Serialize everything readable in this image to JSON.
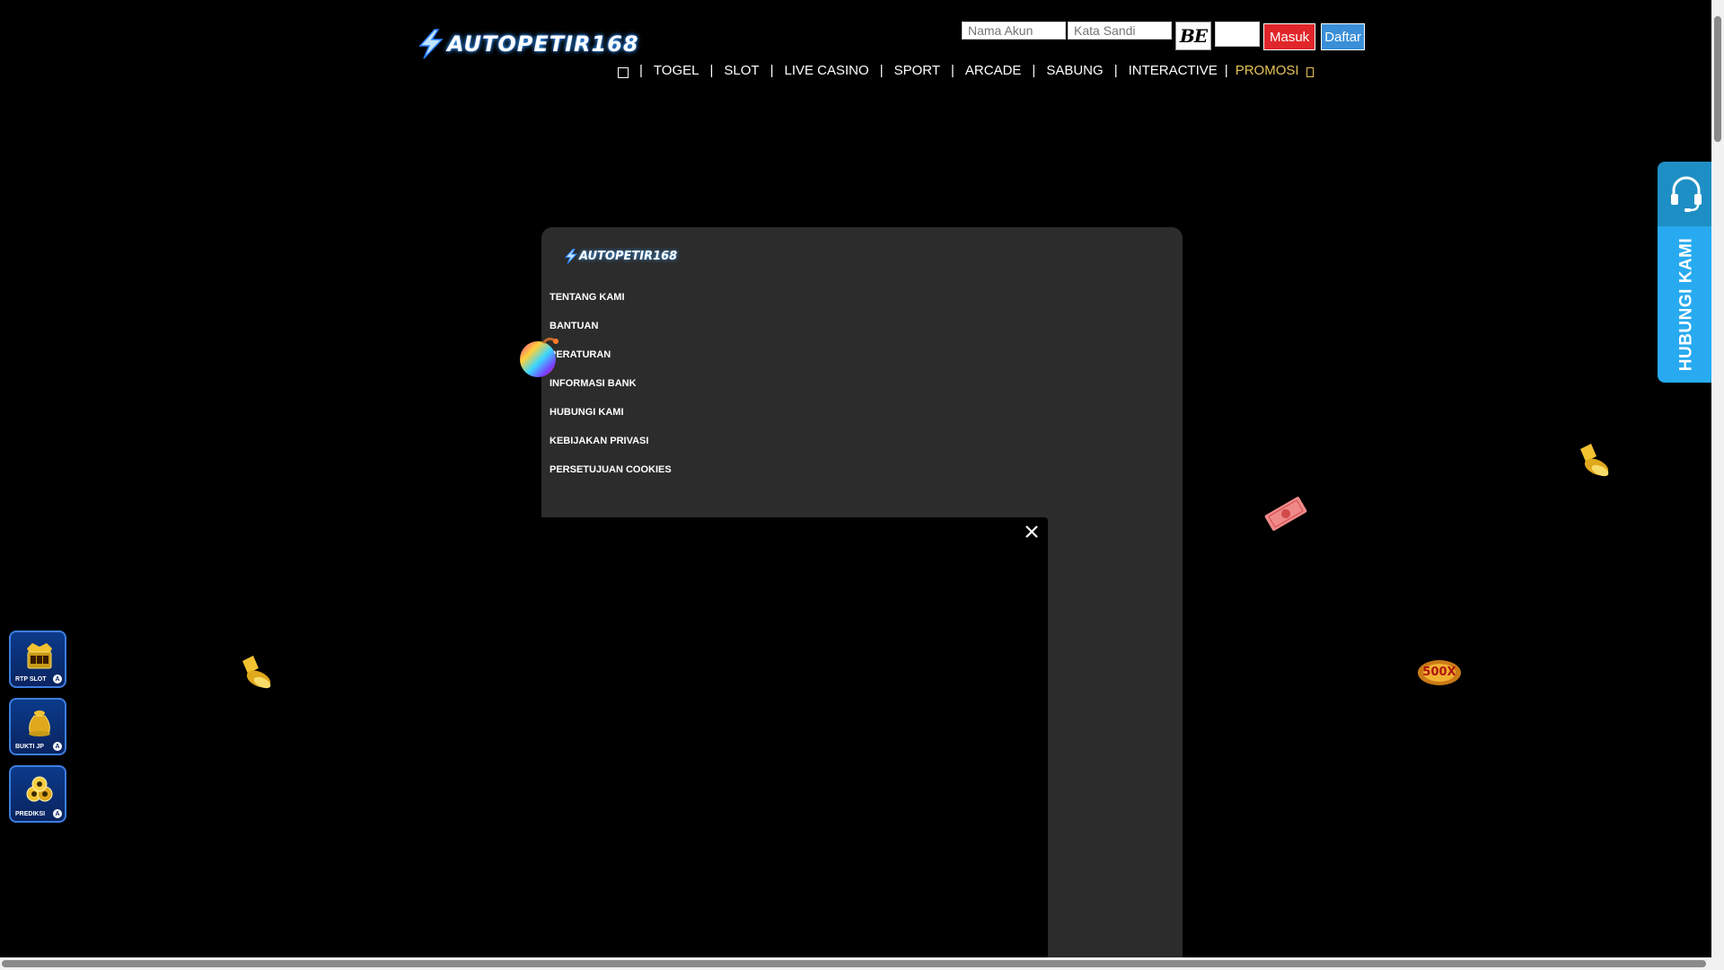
{
  "header": {
    "logo_text": "AUTOPETIR168",
    "username_placeholder": "Nama Akun",
    "password_placeholder": "Kata Sandi",
    "captcha_text": "BE",
    "login_label": "Masuk",
    "register_label": "Daftar"
  },
  "nav": {
    "items": [
      "TOGEL",
      "SLOT",
      "LIVE CASINO",
      "SPORT",
      "ARCADE",
      "SABUNG",
      "INTERACTIVE"
    ],
    "promo": "PROMOSI"
  },
  "panel": {
    "logo_text": "AUTOPETIR168",
    "menu": [
      "TENTANG KAMI",
      "BANTUAN",
      "PERATURAN",
      "INFORMASI BANK",
      "HUBUNGI KAMI",
      "KEBIJAKAN PRIVASI",
      "PERSETUJUAN COOKIES"
    ]
  },
  "contact": {
    "label": "HUBUNGI KAMI"
  },
  "floating": [
    {
      "label": "RTP SLOT",
      "badge": "A"
    },
    {
      "label": "BUKTI JP",
      "badge": "A"
    },
    {
      "label": "PREDIKSI",
      "badge": "A"
    }
  ],
  "deco": {
    "multiplier": "500X"
  },
  "colors": {
    "background": "#000000",
    "panel": "#2c2c2c",
    "promo": "#e8c25a",
    "login_button": "#e0262a",
    "register_button": "#3a8fd8",
    "contact_tab": "#28aaf0"
  },
  "icons": {
    "home": "home-icon",
    "close": "close-icon",
    "headset": "headset-icon"
  }
}
